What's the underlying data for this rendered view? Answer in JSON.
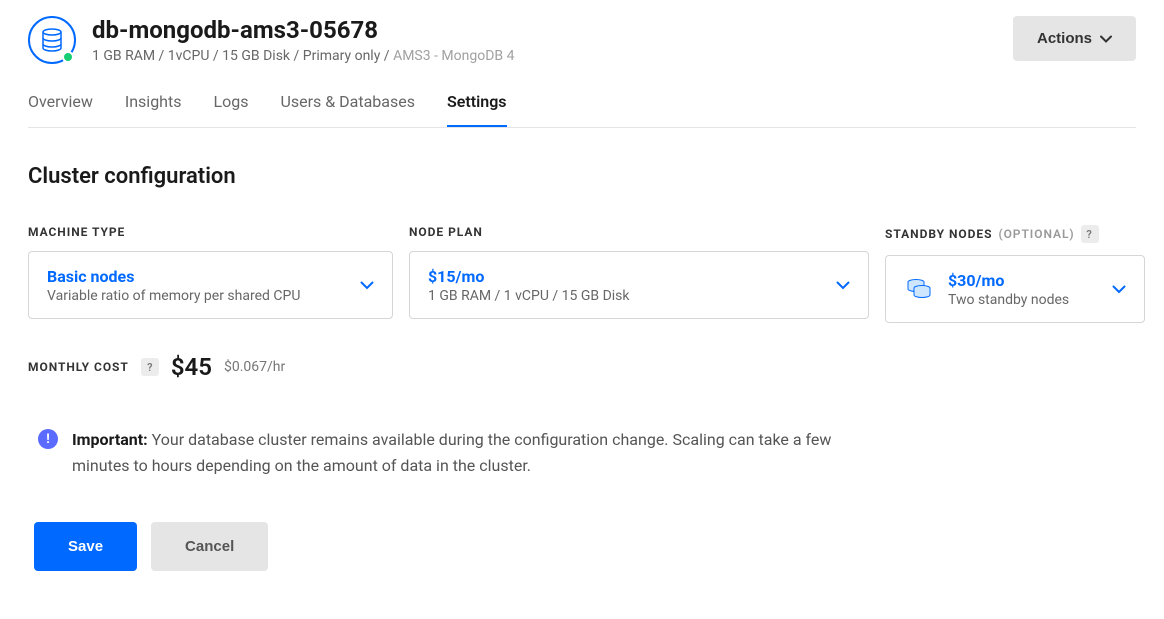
{
  "header": {
    "title": "db-mongodb-ams3-05678",
    "spec": "1 GB RAM / 1vCPU / 15 GB Disk / Primary only / ",
    "spec_muted": "AMS3 - MongoDB 4",
    "actions_label": "Actions"
  },
  "tabs": [
    {
      "label": "Overview",
      "active": false
    },
    {
      "label": "Insights",
      "active": false
    },
    {
      "label": "Logs",
      "active": false
    },
    {
      "label": "Users & Databases",
      "active": false
    },
    {
      "label": "Settings",
      "active": true
    }
  ],
  "section_title": "Cluster configuration",
  "machine_type": {
    "label": "MACHINE TYPE",
    "value_main": "Basic nodes",
    "value_sub": "Variable ratio of memory per shared CPU"
  },
  "node_plan": {
    "label": "NODE PLAN",
    "value_main": "$15/mo",
    "value_sub": "1 GB RAM / 1 vCPU / 15 GB Disk"
  },
  "standby": {
    "label": "STANDBY NODES",
    "optional": "(OPTIONAL)",
    "value_main": "$30/mo",
    "value_sub": "Two standby nodes"
  },
  "cost": {
    "label": "MONTHLY COST",
    "amount": "$45",
    "hourly": "$0.067/hr"
  },
  "notice": {
    "prefix": "Important:",
    "text": " Your database cluster remains available during the configuration change. Scaling can take a few minutes to hours depending on the amount of data in the cluster."
  },
  "buttons": {
    "save": "Save",
    "cancel": "Cancel"
  }
}
